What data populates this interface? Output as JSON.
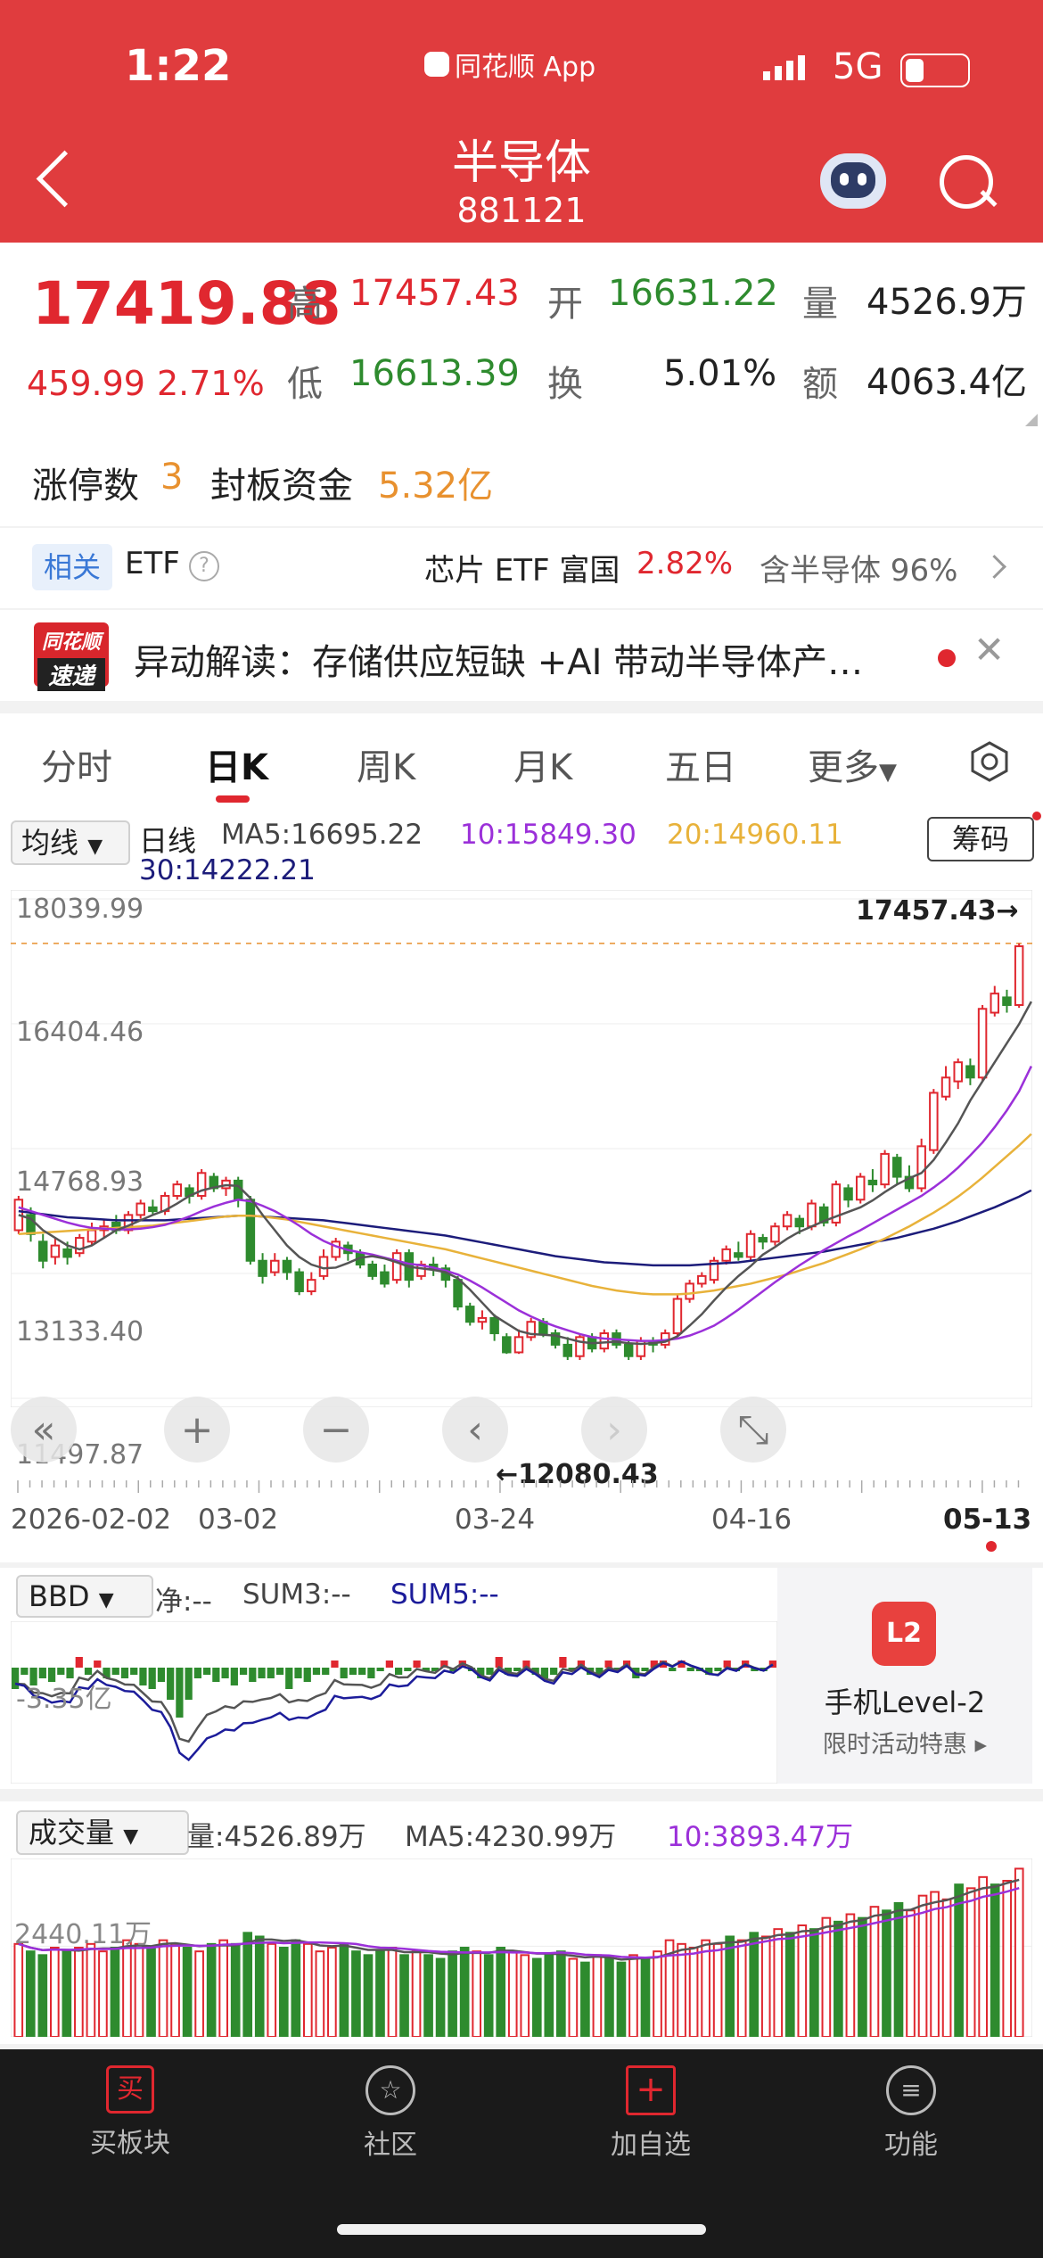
{
  "status_bar": {
    "time": "1:22",
    "app": "同花顺 App",
    "network": "5G"
  },
  "nav": {
    "title": "半导体",
    "code": "881121"
  },
  "quote": {
    "price": "17419.88",
    "change": "459.99",
    "change_pct": "2.71%",
    "high_label": "高",
    "high": "17457.43",
    "open_label": "开",
    "open": "16631.22",
    "vol_label": "量",
    "vol": "4526.9万",
    "low_label": "低",
    "low": "16613.39",
    "turn_label": "换",
    "turn": "5.01%",
    "amt_label": "额",
    "amt": "4063.4亿",
    "limit_up_label": "涨停数",
    "limit_up": "3",
    "seal_label": "封板资金",
    "seal": "5.32亿"
  },
  "etf": {
    "tag": "相关",
    "label": "ETF",
    "name": "芯片 ETF 富国",
    "pct": "2.82%",
    "hold": "含半导体 96%"
  },
  "news": {
    "logo_top": "同花顺",
    "logo_bottom": "速递",
    "text": "异动解读：存储供应短缺 +AI 带动半导体产…"
  },
  "tabs": [
    "分时",
    "日K",
    "周K",
    "月K",
    "五日",
    "更多"
  ],
  "active_tab": 1,
  "ma": {
    "selector": "均线",
    "period": "日线",
    "ma5": "MA5:16695.22",
    "ma10": "10:15849.30",
    "ma20": "20:14960.11",
    "ma30": "30:14222.21",
    "chip_button": "筹码"
  },
  "colors": {
    "up": "#e0272f",
    "down": "#2e8b2e",
    "ma5": "#555555",
    "ma10": "#9b30d9",
    "ma20": "#e8b23a",
    "ma30": "#1c1c7a"
  },
  "chart_data": {
    "type": "candlestick",
    "y_labels": [
      "18039.99",
      "16404.46",
      "14768.93",
      "13133.40",
      "11497.87"
    ],
    "ylim": [
      11497.87,
      18039.99
    ],
    "high_marker": "17457.43→",
    "low_marker": "←12080.43",
    "x_labels": [
      "2026-02-02",
      "03-02",
      "03-24",
      "04-16",
      "05-13"
    ],
    "candles": [
      [
        13700,
        14100,
        13650,
        14150
      ],
      [
        13900,
        13650,
        13550,
        14000
      ],
      [
        13550,
        13300,
        13200,
        13650
      ],
      [
        13350,
        13500,
        13250,
        13600
      ],
      [
        13450,
        13350,
        13250,
        13550
      ],
      [
        13400,
        13600,
        13350,
        13650
      ],
      [
        13550,
        13700,
        13500,
        13800
      ],
      [
        13700,
        13750,
        13600,
        13850
      ],
      [
        13800,
        13700,
        13650,
        13900
      ],
      [
        13700,
        13900,
        13650,
        13950
      ],
      [
        13900,
        14050,
        13850,
        14100
      ],
      [
        14000,
        13950,
        13900,
        14100
      ],
      [
        13950,
        14150,
        13900,
        14200
      ],
      [
        14150,
        14300,
        14100,
        14350
      ],
      [
        14250,
        14150,
        14050,
        14300
      ],
      [
        14150,
        14450,
        14100,
        14500
      ],
      [
        14400,
        14250,
        14200,
        14450
      ],
      [
        14250,
        14350,
        14150,
        14400
      ],
      [
        14350,
        14100,
        14000,
        14400
      ],
      [
        14100,
        13300,
        13250,
        14150
      ],
      [
        13300,
        13100,
        13000,
        13400
      ],
      [
        13150,
        13300,
        13100,
        13400
      ],
      [
        13300,
        13150,
        13050,
        13350
      ],
      [
        13150,
        12900,
        12850,
        13200
      ],
      [
        12900,
        13050,
        12850,
        13150
      ],
      [
        13100,
        13350,
        13050,
        13450
      ],
      [
        13350,
        13550,
        13300,
        13600
      ],
      [
        13500,
        13400,
        13300,
        13550
      ],
      [
        13400,
        13250,
        13200,
        13450
      ],
      [
        13250,
        13100,
        13050,
        13300
      ],
      [
        13150,
        13000,
        12950,
        13250
      ],
      [
        13050,
        13400,
        13000,
        13450
      ],
      [
        13400,
        13050,
        12950,
        13450
      ],
      [
        13100,
        13250,
        13050,
        13300
      ],
      [
        13250,
        13200,
        13100,
        13350
      ],
      [
        13200,
        13050,
        12950,
        13250
      ],
      [
        13050,
        12700,
        12650,
        13100
      ],
      [
        12700,
        12500,
        12450,
        12750
      ],
      [
        12500,
        12550,
        12400,
        12650
      ],
      [
        12550,
        12350,
        12250,
        12600
      ],
      [
        12300,
        12100,
        12080,
        12350
      ],
      [
        12100,
        12300,
        12080,
        12400
      ],
      [
        12300,
        12500,
        12250,
        12550
      ],
      [
        12500,
        12350,
        12300,
        12550
      ],
      [
        12350,
        12200,
        12150,
        12400
      ],
      [
        12200,
        12050,
        12000,
        12300
      ],
      [
        12050,
        12300,
        12000,
        12350
      ],
      [
        12300,
        12150,
        12100,
        12350
      ],
      [
        12150,
        12350,
        12100,
        12400
      ],
      [
        12350,
        12200,
        12150,
        12400
      ],
      [
        12200,
        12050,
        12000,
        12250
      ],
      [
        12050,
        12250,
        12000,
        12300
      ],
      [
        12250,
        12200,
        12100,
        12300
      ],
      [
        12200,
        12350,
        12150,
        12400
      ],
      [
        12350,
        12800,
        12300,
        12850
      ],
      [
        12800,
        13000,
        12750,
        13050
      ],
      [
        13000,
        13100,
        12950,
        13150
      ],
      [
        13050,
        13300,
        13000,
        13350
      ],
      [
        13300,
        13450,
        13250,
        13500
      ],
      [
        13400,
        13350,
        13300,
        13550
      ],
      [
        13350,
        13650,
        13300,
        13700
      ],
      [
        13600,
        13550,
        13450,
        13650
      ],
      [
        13550,
        13750,
        13500,
        13800
      ],
      [
        13750,
        13900,
        13700,
        13950
      ],
      [
        13850,
        13750,
        13650,
        13900
      ],
      [
        13750,
        14050,
        13700,
        14100
      ],
      [
        14000,
        13800,
        13750,
        14050
      ],
      [
        13800,
        14300,
        13750,
        14350
      ],
      [
        14250,
        14100,
        14000,
        14300
      ],
      [
        14100,
        14400,
        14050,
        14450
      ],
      [
        14350,
        14300,
        14200,
        14500
      ],
      [
        14300,
        14700,
        14250,
        14750
      ],
      [
        14650,
        14400,
        14300,
        14700
      ],
      [
        14400,
        14250,
        14200,
        14550
      ],
      [
        14250,
        14800,
        14200,
        14900
      ],
      [
        14750,
        15500,
        14700,
        15550
      ],
      [
        15450,
        15700,
        15400,
        15850
      ],
      [
        15650,
        15900,
        15550,
        15950
      ],
      [
        15850,
        15700,
        15600,
        15950
      ],
      [
        15700,
        16600,
        15650,
        16650
      ],
      [
        16550,
        16800,
        16500,
        16900
      ],
      [
        16750,
        16650,
        16550,
        16850
      ],
      [
        16650,
        17419.88,
        16613.39,
        17457.43
      ]
    ],
    "ma5": [
      13900,
      13850,
      13700,
      13600,
      13500,
      13450,
      13500,
      13600,
      13700,
      13760,
      13830,
      13900,
      13960,
      14050,
      14150,
      14220,
      14260,
      14290,
      14280,
      14120,
      13900,
      13700,
      13500,
      13350,
      13250,
      13200,
      13210,
      13270,
      13340,
      13360,
      13330,
      13280,
      13220,
      13200,
      13180,
      13150,
      13070,
      12920,
      12750,
      12580,
      12480,
      12380,
      12340,
      12330,
      12320,
      12280,
      12240,
      12220,
      12230,
      12240,
      12220,
      12210,
      12220,
      12240,
      12310,
      12450,
      12600,
      12780,
      12950,
      13100,
      13230,
      13380,
      13480,
      13590,
      13680,
      13750,
      13820,
      13880,
      13940,
      14000,
      14090,
      14200,
      14300,
      14380,
      14450,
      14620,
      14850,
      15100,
      15400,
      15650,
      15900,
      16150,
      16400,
      16695
    ],
    "ma10": [
      14000,
      13950,
      13900,
      13850,
      13800,
      13760,
      13730,
      13720,
      13710,
      13710,
      13720,
      13740,
      13770,
      13820,
      13880,
      13950,
      14010,
      14060,
      14100,
      14080,
      14020,
      13950,
      13860,
      13760,
      13650,
      13560,
      13490,
      13440,
      13410,
      13380,
      13340,
      13300,
      13260,
      13240,
      13210,
      13170,
      13120,
      13040,
      12950,
      12850,
      12750,
      12650,
      12570,
      12500,
      12440,
      12390,
      12340,
      12300,
      12280,
      12270,
      12260,
      12250,
      12250,
      12260,
      12280,
      12320,
      12380,
      12450,
      12550,
      12660,
      12780,
      12900,
      13020,
      13130,
      13240,
      13340,
      13440,
      13530,
      13620,
      13700,
      13790,
      13880,
      13970,
      14060,
      14150,
      14260,
      14380,
      14520,
      14680,
      14850,
      15050,
      15270,
      15520,
      15849
    ],
    "ma20": [
      13650,
      13660,
      13670,
      13680,
      13690,
      13700,
      13710,
      13720,
      13730,
      13740,
      13750,
      13760,
      13780,
      13800,
      13820,
      13840,
      13860,
      13880,
      13890,
      13890,
      13880,
      13860,
      13840,
      13810,
      13780,
      13750,
      13720,
      13690,
      13660,
      13630,
      13600,
      13570,
      13540,
      13510,
      13480,
      13450,
      13410,
      13370,
      13330,
      13290,
      13250,
      13210,
      13170,
      13130,
      13090,
      13050,
      13010,
      12970,
      12940,
      12910,
      12890,
      12870,
      12860,
      12860,
      12860,
      12870,
      12890,
      12910,
      12940,
      12970,
      13000,
      13040,
      13080,
      13120,
      13170,
      13220,
      13270,
      13330,
      13390,
      13450,
      13520,
      13590,
      13670,
      13750,
      13840,
      13930,
      14030,
      14140,
      14260,
      14390,
      14530,
      14670,
      14810,
      14960
    ],
    "ma30": [
      13950,
      13930,
      13910,
      13890,
      13870,
      13860,
      13850,
      13840,
      13830,
      13830,
      13830,
      13830,
      13830,
      13840,
      13850,
      13860,
      13870,
      13880,
      13890,
      13890,
      13880,
      13870,
      13860,
      13850,
      13840,
      13830,
      13810,
      13790,
      13770,
      13750,
      13730,
      13710,
      13690,
      13670,
      13650,
      13630,
      13600,
      13570,
      13540,
      13510,
      13480,
      13450,
      13420,
      13390,
      13360,
      13340,
      13320,
      13300,
      13280,
      13270,
      13260,
      13250,
      13240,
      13240,
      13240,
      13240,
      13250,
      13260,
      13270,
      13280,
      13300,
      13320,
      13340,
      13360,
      13380,
      13400,
      13420,
      13450,
      13480,
      13510,
      13540,
      13570,
      13600,
      13640,
      13680,
      13720,
      13770,
      13820,
      13880,
      13940,
      14000,
      14070,
      14140,
      14222
    ]
  },
  "bbd": {
    "selector": "BBD",
    "net": "净:--",
    "sum3": "SUM3:--",
    "sum5": "SUM5:--",
    "scale": "-3.35亿",
    "values": [
      -6,
      -2,
      -5,
      -3,
      -4,
      -2,
      -3,
      3,
      -2,
      2,
      -3,
      -2,
      -3,
      -2,
      -5,
      -6,
      -4,
      -9,
      -14,
      -9,
      -3,
      -2,
      -4,
      -3,
      -5,
      -2,
      -4,
      -3,
      -3,
      -2,
      -6,
      -3,
      -4,
      -2,
      -2,
      2,
      -3,
      -2,
      -2,
      -3,
      -1,
      2,
      -2,
      -1,
      2,
      -1,
      -1,
      2,
      -1,
      2,
      -1,
      -3,
      -2,
      3,
      -2,
      -1,
      2,
      -2,
      -3,
      -2,
      3,
      -1,
      2,
      -2,
      -2,
      2,
      -1,
      2,
      -3,
      -1,
      2,
      2,
      -1,
      2,
      -1,
      -1,
      -2,
      -1,
      2,
      -1,
      2,
      -1,
      -1,
      2
    ],
    "promo_title": "手机Level-2",
    "promo_sub": "限时活动特惠"
  },
  "volume": {
    "selector": "成交量",
    "vol": "量:4526.89万",
    "ma5": "MA5:4230.99万",
    "ma10": "10:3893.47万",
    "scale": "2440.11万",
    "values": [
      2500,
      2300,
      2200,
      2400,
      2300,
      2400,
      2500,
      2300,
      2400,
      2600,
      2500,
      2400,
      2600,
      2500,
      2400,
      2300,
      2500,
      2600,
      2500,
      2800,
      2700,
      2500,
      2400,
      2600,
      2500,
      2300,
      2400,
      2500,
      2300,
      2200,
      2300,
      2400,
      2200,
      2300,
      2200,
      2100,
      2300,
      2400,
      2300,
      2200,
      2400,
      2300,
      2200,
      2100,
      2200,
      2300,
      2100,
      2000,
      2200,
      2100,
      2000,
      2200,
      2100,
      2300,
      2600,
      2500,
      2400,
      2600,
      2500,
      2700,
      2600,
      2800,
      2700,
      2900,
      2800,
      3000,
      2900,
      3200,
      3100,
      3300,
      3200,
      3500,
      3400,
      3600,
      3400,
      3800,
      3900,
      3700,
      4100,
      4000,
      4300,
      4100,
      4200,
      4526
    ]
  },
  "bottom_nav": {
    "items": [
      {
        "label": "买板块",
        "icon": "buy-icon"
      },
      {
        "label": "社区",
        "icon": "community-icon"
      },
      {
        "label": "加自选",
        "icon": "add-watch-icon"
      },
      {
        "label": "功能",
        "icon": "menu-icon"
      }
    ],
    "buy_glyph": "买"
  }
}
